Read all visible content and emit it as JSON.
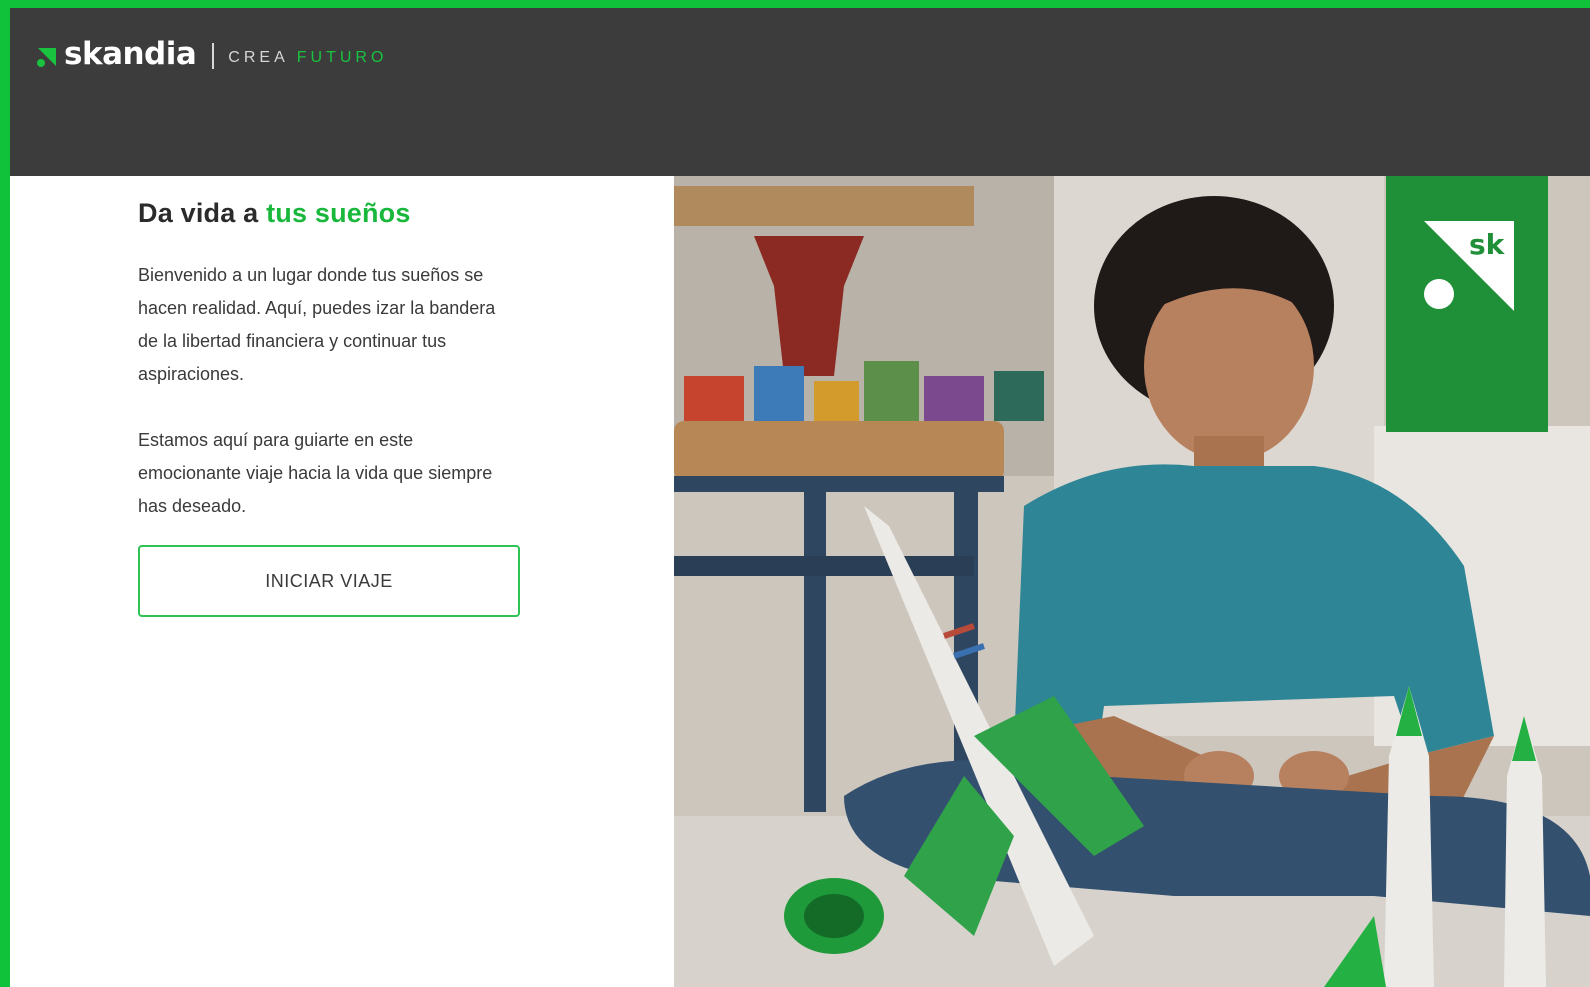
{
  "brand": {
    "name": "skandia",
    "tagline_word1": "CREA",
    "tagline_word2": "FUTURO",
    "accent_color": "#19c23f"
  },
  "hero_text": {
    "title_plain": "Da vida a ",
    "title_accent": "tus sueños",
    "paragraph1": "Bienvenido a un lugar donde tus sueños se hacen realidad. Aquí, puedes izar la bandera de la libertad financiera y continuar tus aspiraciones.",
    "paragraph2": "Estamos aquí para guiarte en este emocionante viaje hacia la vida que siempre has deseado.",
    "cta_label": "INICIAR VIAJE"
  },
  "hero_image": {
    "banner_text": "sk"
  },
  "colors": {
    "header_bg": "#3c3c3c",
    "page_border": "#0fc23a",
    "accent": "#19b83c"
  }
}
